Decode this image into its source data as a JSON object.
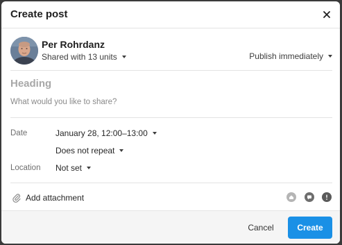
{
  "dialog": {
    "title": "Create post"
  },
  "author": {
    "name": "Per Rohrdanz",
    "shared_with": "Shared with 13 units",
    "publish": "Publish immediately"
  },
  "composer": {
    "heading_placeholder": "Heading",
    "body_placeholder": "What would you like to share?"
  },
  "fields": {
    "date_label": "Date",
    "date_value": "January 28, 12:00–13:00",
    "repeat_value": "Does not repeat",
    "location_label": "Location",
    "location_value": "Not set"
  },
  "attachment": {
    "label": "Add attachment",
    "icons": [
      "home-icon",
      "chat-icon",
      "alert-icon"
    ]
  },
  "footer": {
    "cancel_label": "Cancel",
    "create_label": "Create"
  },
  "colors": {
    "primary": "#1a90e6",
    "icon_gray": "#8c8c8c",
    "alert_dark": "#5a5a5a"
  }
}
